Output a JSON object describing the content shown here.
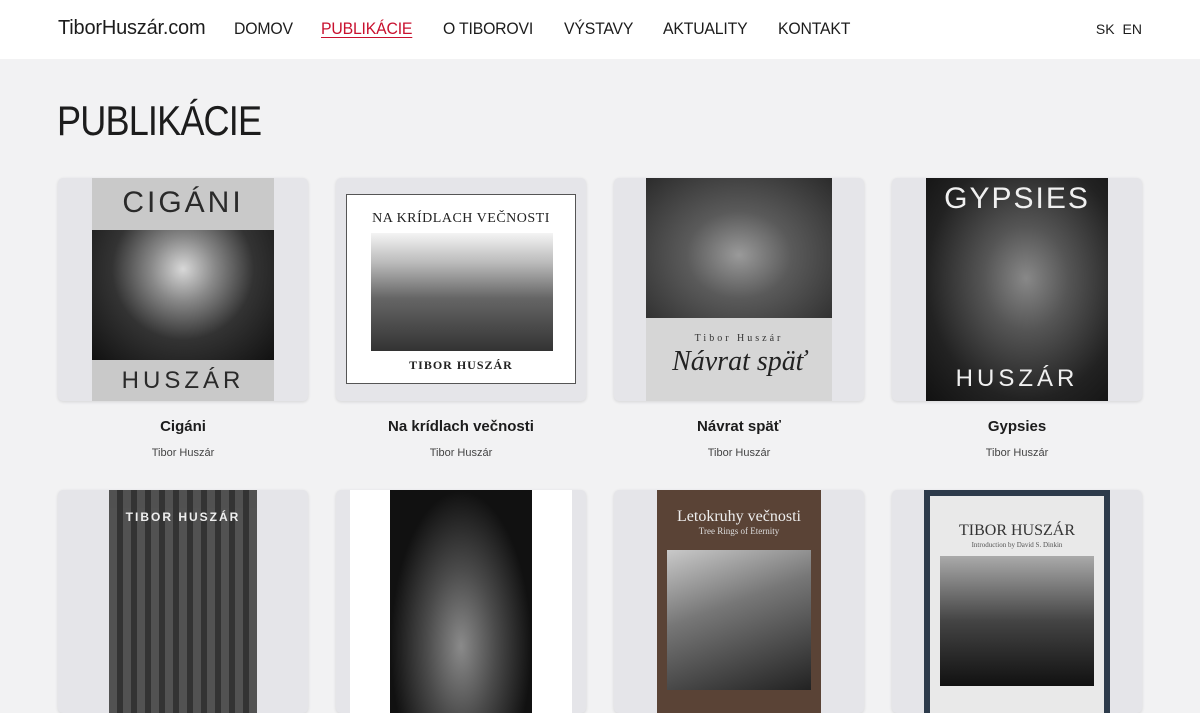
{
  "header": {
    "brand": "TiborHuszár.com",
    "nav": [
      "DOMOV",
      "PUBLIKÁCIE",
      "O TIBOROVI",
      "VÝSTAVY",
      "AKTUALITY",
      "KONTAKT"
    ],
    "active_nav": "PUBLIKÁCIE",
    "lang": [
      "SK",
      "EN"
    ]
  },
  "page": {
    "title": "PUBLIKÁCIE"
  },
  "books": [
    {
      "title": "Cigáni",
      "author": "Tibor Huszár",
      "cover_top": "CIGÁNI",
      "cover_bottom": "HUSZÁR"
    },
    {
      "title": "Na krídlach večnosti",
      "author": "Tibor Huszár",
      "cover_top": "NA KRÍDLACH VEČNOSTI",
      "cover_bottom": "TIBOR HUSZÁR"
    },
    {
      "title": "Návrat späť",
      "author": "Tibor Huszár",
      "cover_author": "Tibor Huszár",
      "cover_title": "Návrat späť"
    },
    {
      "title": "Gypsies",
      "author": "Tibor Huszár",
      "cover_top": "GYPSIES",
      "cover_bottom": "HUSZÁR"
    },
    {
      "cover_top": "TIBOR HUSZÁR"
    },
    {},
    {
      "cover_top": "Letokruhy večnosti",
      "cover_sub": "Tree Rings of Eternity"
    },
    {
      "cover_top": "TIBOR HUSZÁR",
      "cover_sub": "Introduction by David S. Dinkin"
    }
  ],
  "colors": {
    "accent": "#c8102e",
    "background": "#f2f2f3",
    "card": "#e5e5e9"
  }
}
